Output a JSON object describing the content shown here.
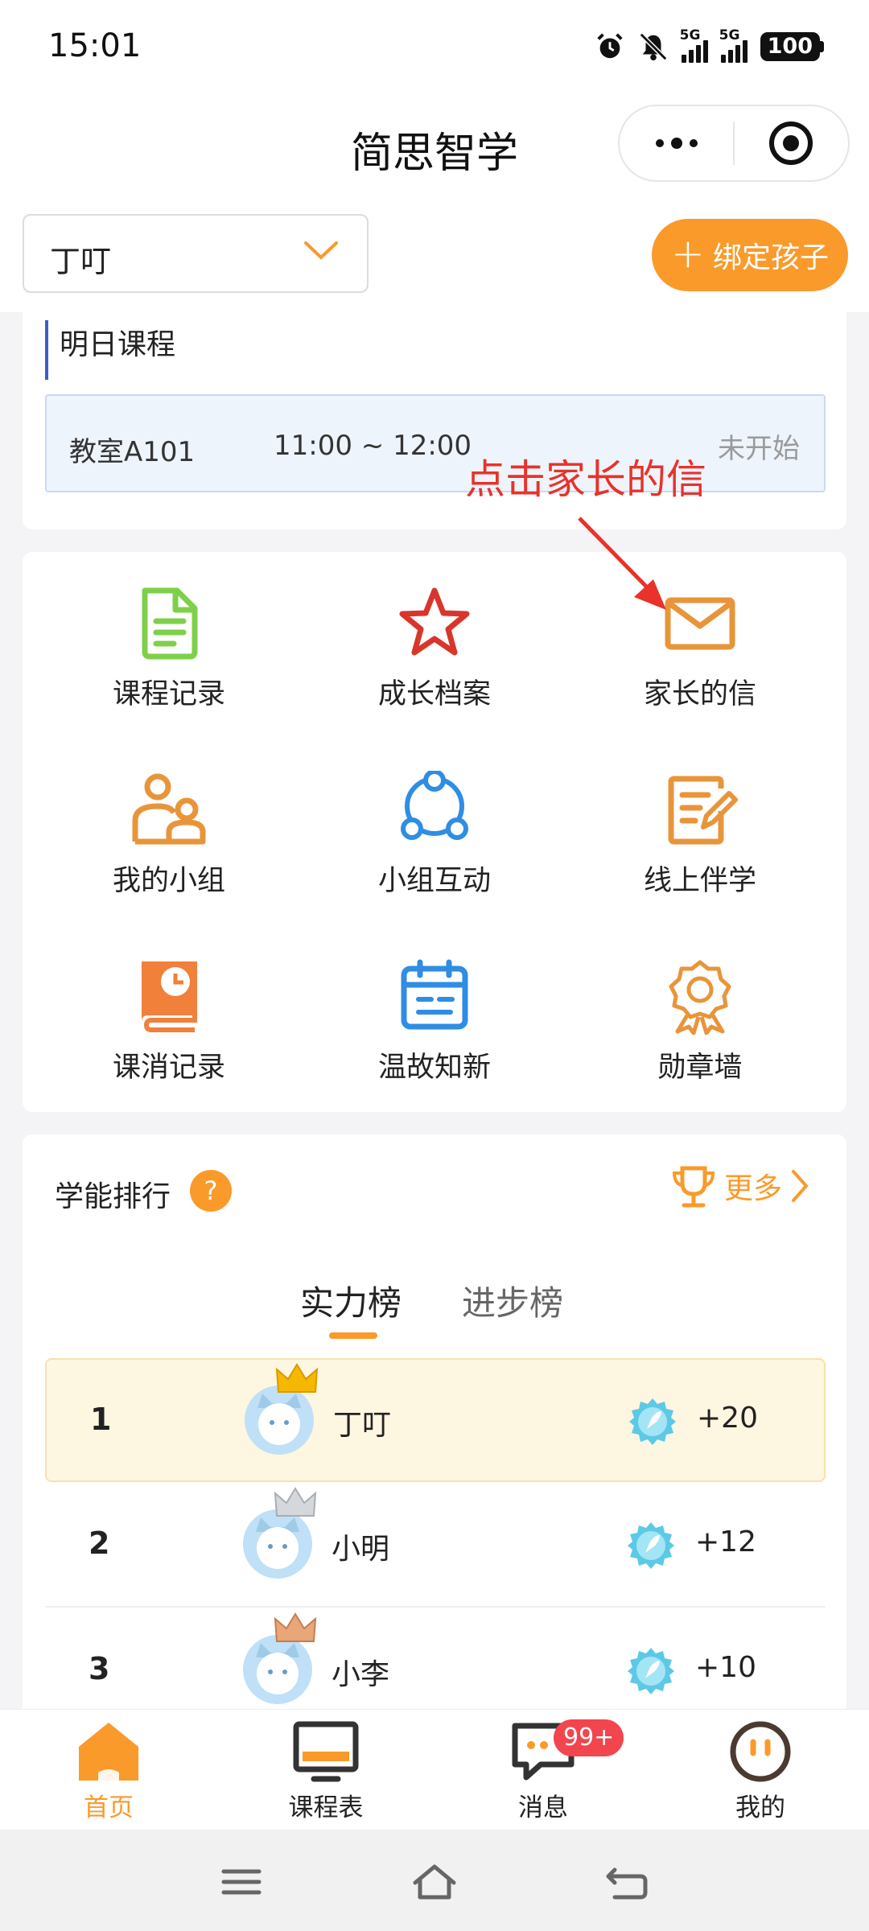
{
  "status_bar": {
    "time": "15:01",
    "network_1": "5G",
    "network_2": "5G",
    "battery": "100"
  },
  "header": {
    "title": "简思智学"
  },
  "child_selector": {
    "selected": "丁叮",
    "bind_button": "绑定孩子"
  },
  "course": {
    "section_title": "明日课程",
    "room": "教室A101",
    "time": "11:00 ~ 12:00",
    "status": "未开始"
  },
  "annotation": {
    "text": "点击家长的信"
  },
  "menu": {
    "items": [
      {
        "label": "课程记录",
        "icon": "document-icon",
        "color": "#7ed04b"
      },
      {
        "label": "成长档案",
        "icon": "star-icon",
        "color": "#d9362b"
      },
      {
        "label": "家长的信",
        "icon": "envelope-icon",
        "color": "#e8953a"
      },
      {
        "label": "我的小组",
        "icon": "group-members-icon",
        "color": "#e8953a"
      },
      {
        "label": "小组互动",
        "icon": "share-network-icon",
        "color": "#2f8de4"
      },
      {
        "label": "线上伴学",
        "icon": "edit-note-icon",
        "color": "#e8953a"
      },
      {
        "label": "课消记录",
        "icon": "book-clock-icon",
        "color": "#f0803a"
      },
      {
        "label": "温故知新",
        "icon": "calendar-icon",
        "color": "#2f8de4"
      },
      {
        "label": "勋章墙",
        "icon": "award-ribbon-icon",
        "color": "#e8953a"
      }
    ]
  },
  "ranking": {
    "title": "学能排行",
    "help": "?",
    "more": "更多",
    "tabs": [
      "实力榜",
      "进步榜"
    ],
    "rows": [
      {
        "rank": "1",
        "name": "丁叮",
        "score": "+20",
        "crown": "gold"
      },
      {
        "rank": "2",
        "name": "小明",
        "score": "+12",
        "crown": "silver"
      },
      {
        "rank": "3",
        "name": "小李",
        "score": "+10",
        "crown": "bronze"
      }
    ]
  },
  "tabbar": {
    "items": [
      {
        "label": "首页",
        "icon": "home-icon"
      },
      {
        "label": "课程表",
        "icon": "monitor-icon"
      },
      {
        "label": "消息",
        "icon": "message-icon",
        "badge": "99+"
      },
      {
        "label": "我的",
        "icon": "profile-face-icon"
      }
    ]
  },
  "colors": {
    "accent": "#fa9a2a",
    "annotation": "#e8322a",
    "course_accent": "#3c5ec9",
    "badge": "#f2454e"
  }
}
